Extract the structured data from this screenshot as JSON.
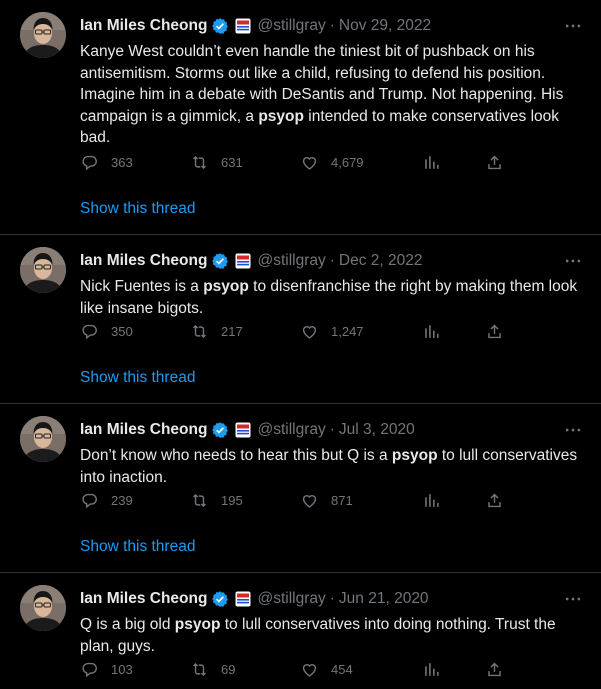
{
  "colors": {
    "background": "#000000",
    "text": "#e7e9ea",
    "muted": "#71767b",
    "link": "#1d9bf0",
    "verified": "#1d9bf0",
    "divider": "#2f3336"
  },
  "tweets": [
    {
      "author": "Ian Miles Cheong",
      "handle": "@stillgray",
      "separator": "·",
      "date": "Nov 29, 2022",
      "text_parts": [
        "Kanye West couldn’t even handle the tiniest bit of pushback on his antisemitism. Storms out like a child, refusing to defend his position. Imagine him in a debate with DeSantis and Trump. Not happening. His campaign is a gimmick, a ",
        "psyop",
        " intended to make conservatives look bad."
      ],
      "replies": "363",
      "retweets": "631",
      "likes": "4,679",
      "thread_link": "Show this thread"
    },
    {
      "author": "Ian Miles Cheong",
      "handle": "@stillgray",
      "separator": "·",
      "date": "Dec 2, 2022",
      "text_parts": [
        "Nick Fuentes is a ",
        "psyop",
        " to disenfranchise the right by making them look like insane bigots."
      ],
      "replies": "350",
      "retweets": "217",
      "likes": "1,247",
      "thread_link": "Show this thread"
    },
    {
      "author": "Ian Miles Cheong",
      "handle": "@stillgray",
      "separator": "·",
      "date": "Jul 3, 2020",
      "text_parts": [
        "Don’t know who needs to hear this but Q is a ",
        "psyop",
        " to lull conservatives into inaction."
      ],
      "replies": "239",
      "retweets": "195",
      "likes": "871",
      "thread_link": "Show this thread"
    },
    {
      "author": "Ian Miles Cheong",
      "handle": "@stillgray",
      "separator": "·",
      "date": "Jun 21, 2020",
      "text_parts": [
        "Q is a big old ",
        "psyop",
        " to lull conservatives into doing nothing. Trust the plan, guys."
      ],
      "replies": "103",
      "retweets": "69",
      "likes": "454"
    }
  ]
}
